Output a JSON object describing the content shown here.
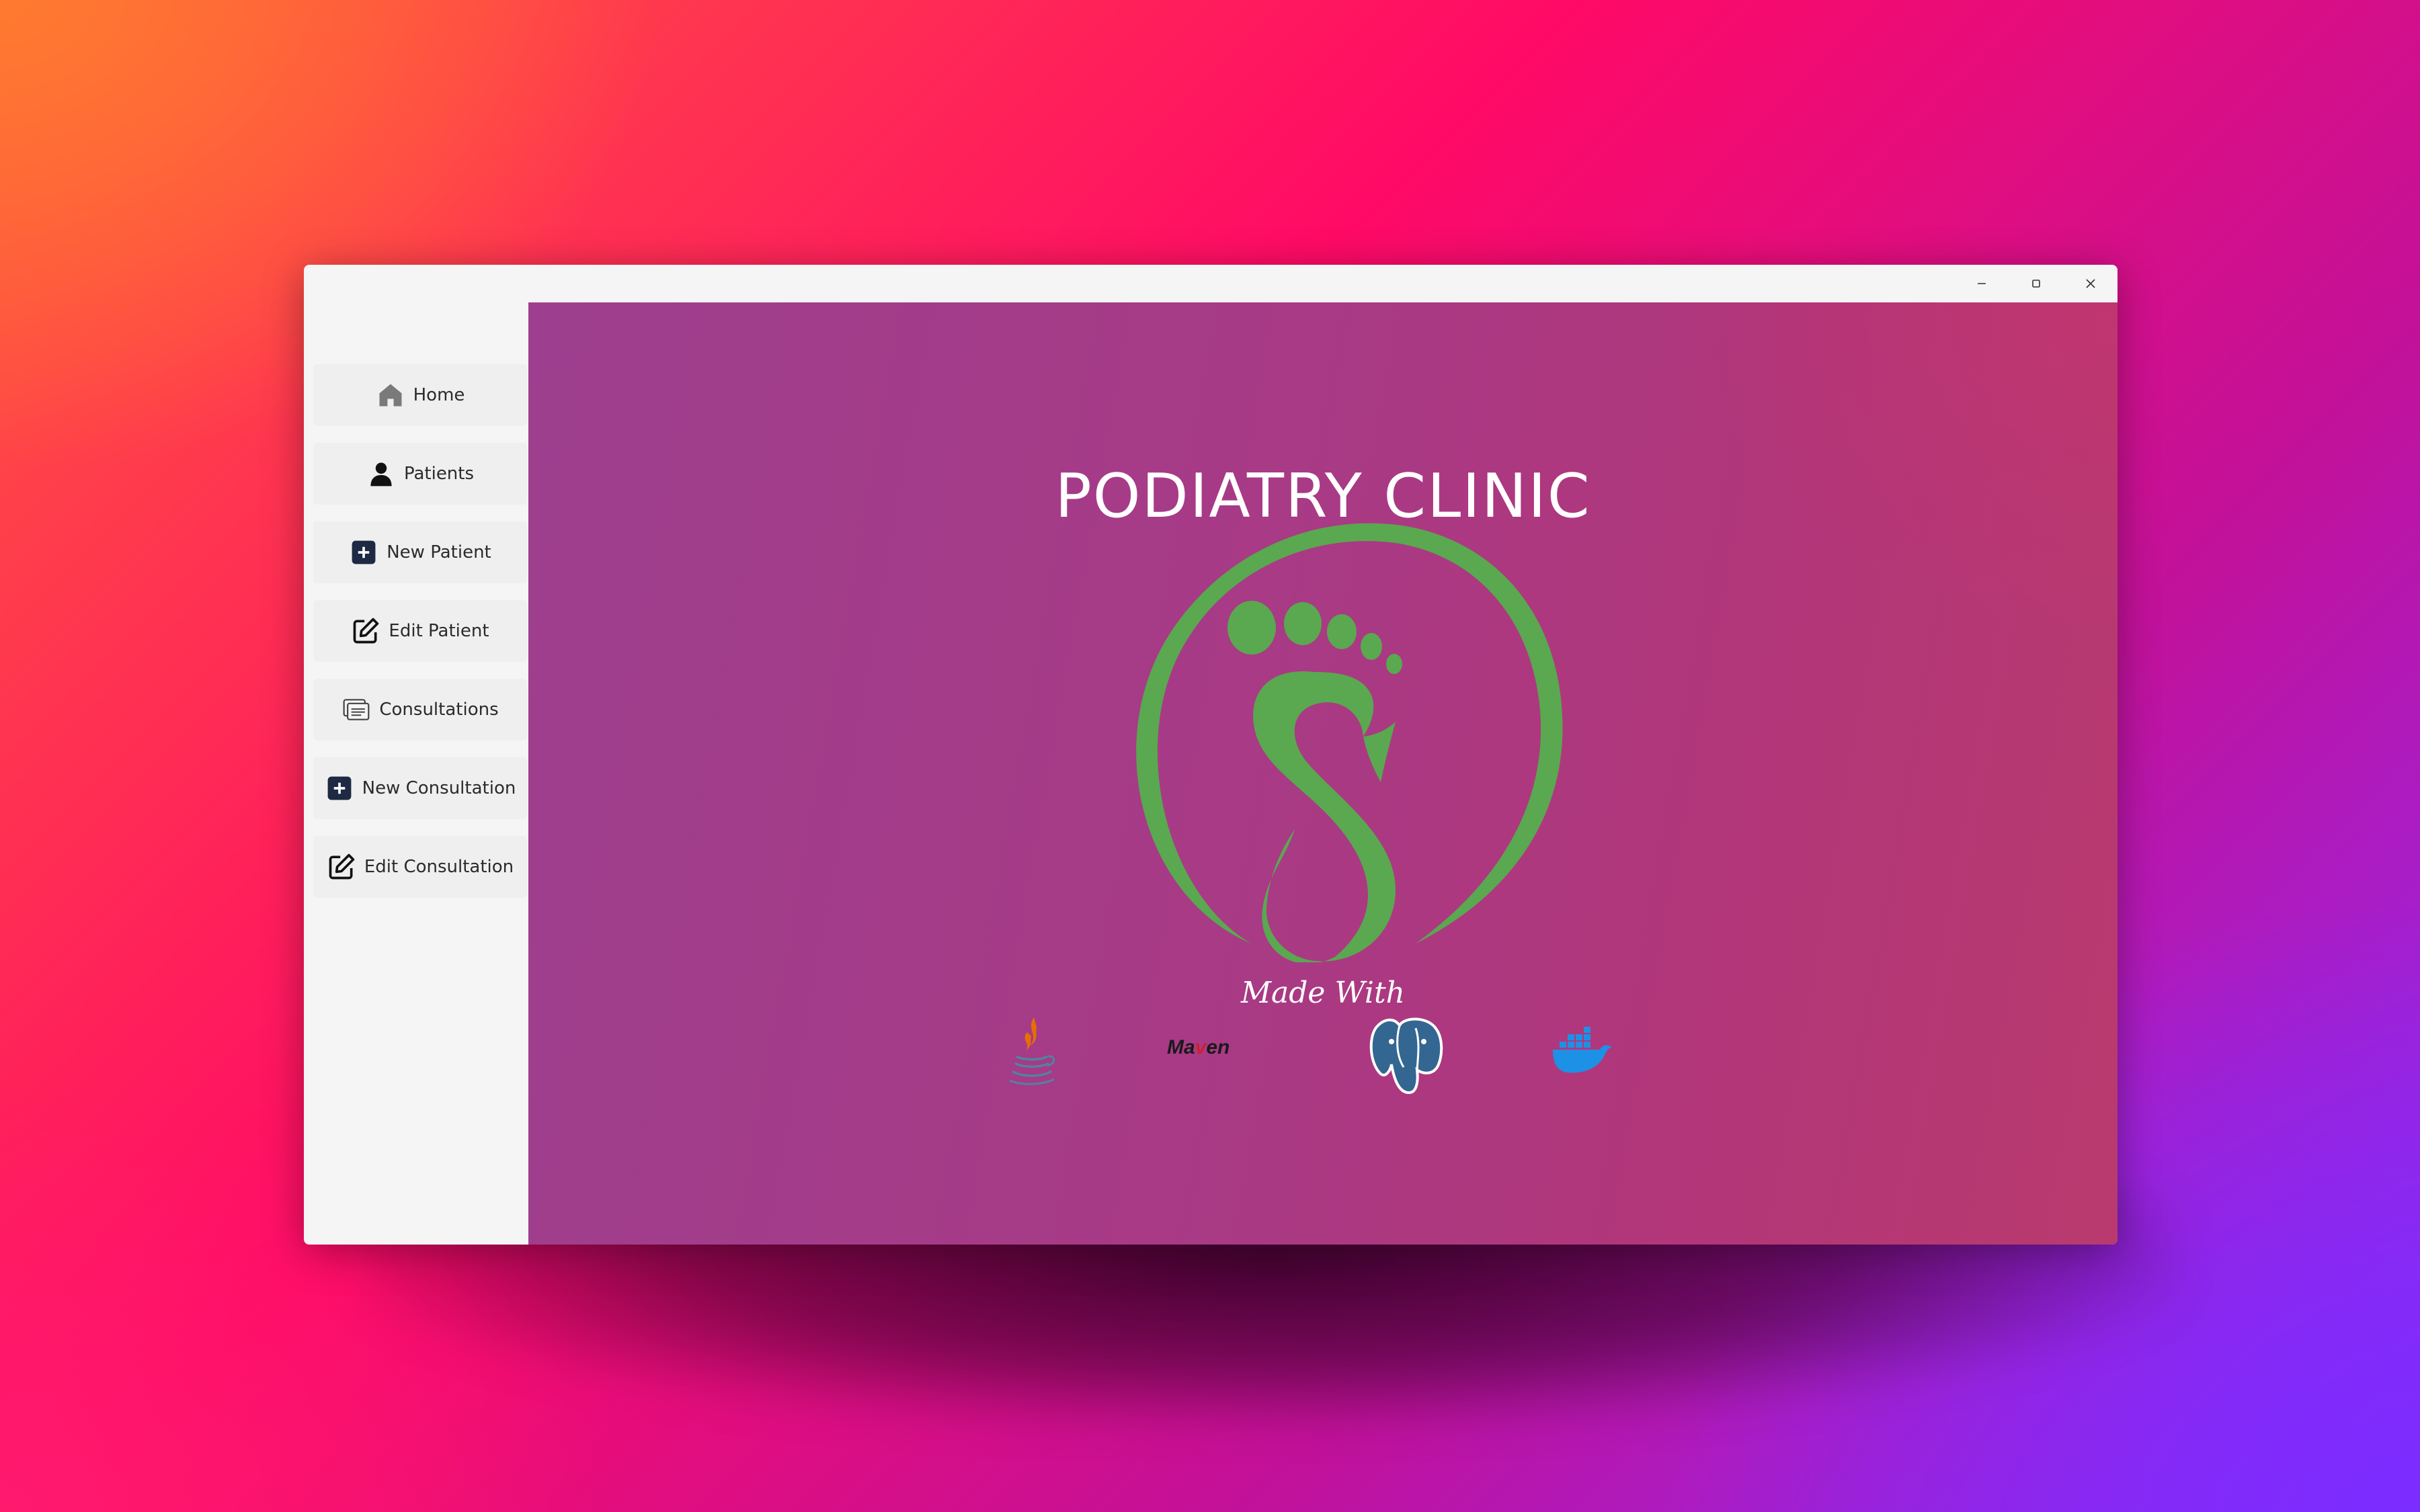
{
  "window": {
    "controls": [
      "minimize-icon",
      "maximize-icon",
      "close-icon"
    ]
  },
  "sidebar": {
    "items": [
      {
        "label": "Home",
        "icon": "home-icon"
      },
      {
        "label": "Patients",
        "icon": "person-icon"
      },
      {
        "label": "New Patient",
        "icon": "plus-square-icon"
      },
      {
        "label": "Edit Patient",
        "icon": "edit-icon"
      },
      {
        "label": "Consultations",
        "icon": "cards-icon"
      },
      {
        "label": "New Consultation",
        "icon": "plus-square-icon"
      },
      {
        "label": "Edit Consultation",
        "icon": "edit-icon"
      }
    ]
  },
  "main": {
    "title": "PODIATRY CLINIC",
    "logo": "foot-logo",
    "made_with": "Made With",
    "maven_logo": {
      "prefix": "Ma",
      "mark": "v",
      "suffix": "en"
    },
    "tech_icons": [
      "java-icon",
      "maven-logo",
      "postgresql-icon",
      "docker-icon"
    ]
  },
  "colors": {
    "logo_green": "#5aa84f",
    "content_left": "#9d3f8e",
    "content_right": "#b93a6e",
    "sidebar_bg": "#f5f5f5"
  }
}
